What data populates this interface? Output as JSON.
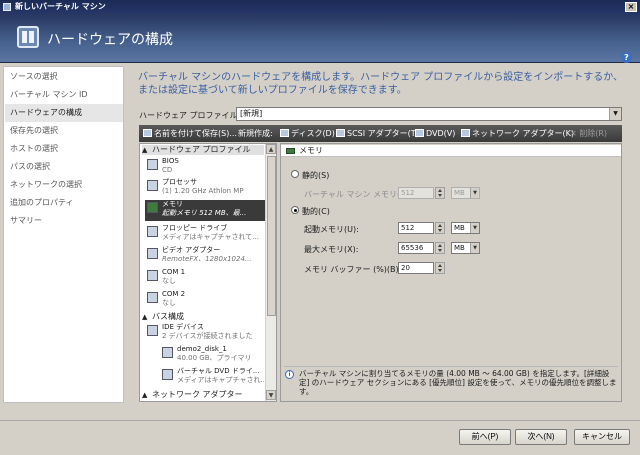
{
  "window": {
    "title": "新しいバーチャル マシン",
    "close_glyph": "×"
  },
  "header": {
    "title": "ハードウェアの構成",
    "help_glyph": "?"
  },
  "sidebar": {
    "items": [
      {
        "label": "ソースの選択",
        "active": false
      },
      {
        "label": "バーチャル マシン ID",
        "active": false
      },
      {
        "label": "ハードウェアの構成",
        "active": true
      },
      {
        "label": "保存先の選択",
        "active": false
      },
      {
        "label": "ホストの選択",
        "active": false
      },
      {
        "label": "パスの選択",
        "active": false
      },
      {
        "label": "ネットワークの選択",
        "active": false
      },
      {
        "label": "追加のプロパティ",
        "active": false
      },
      {
        "label": "サマリー",
        "active": false
      }
    ]
  },
  "intro": {
    "text": "バーチャル マシンのハードウェアを構成します。ハードウェア プロファイルから設定をインポートするか、または設定に基づいて新しいプロファイルを保存できます。"
  },
  "profile": {
    "label": "ハードウェア プロファイル(A):",
    "value": "[新規]"
  },
  "toolbar": {
    "save_as": "名前を付けて保存(S)...",
    "new": "新規作成:",
    "disk": "ディスク(D)",
    "scsi": "SCSI アダプター(T)",
    "dvd": "DVD(V)",
    "network": "ネットワーク アダプター(K)",
    "delete": "削除(R)"
  },
  "tree": {
    "cat_hw": "ハードウェア プロファイル",
    "cat_bus": "バス構成",
    "cat_net": "ネットワーク アダプター",
    "items": {
      "bios": {
        "name": "BIOS",
        "sub": "CD"
      },
      "cpu": {
        "name": "プロセッサ",
        "sub": "(1) 1.20 GHz Athlon MP"
      },
      "memory": {
        "name": "メモリ",
        "sub": "起動メモリ 512 MB、最..."
      },
      "floppy": {
        "name": "フロッピー ドライブ",
        "sub": "メディアはキャプチャされて..."
      },
      "video": {
        "name": "ビデオ アダプター",
        "sub": "RemoteFX、1280x1024..."
      },
      "com1": {
        "name": "COM 1",
        "sub": "なし"
      },
      "com2": {
        "name": "COM 2",
        "sub": "なし"
      },
      "ide": {
        "name": "IDE デバイス",
        "sub": "2 デバイスが接続されました"
      },
      "disk": {
        "name": "demo2_disk_1",
        "sub": "40.00 GB、プライマリ"
      },
      "dvd": {
        "name": "バーチャル DVD ドライ...",
        "sub": "メディアはキャプチャされ..."
      }
    }
  },
  "memory_pane": {
    "header": "メモリ",
    "static_label": "静的(S)",
    "static_mem_label": "バーチャル マシン メモリ(M):",
    "static_mem_value": "512",
    "static_mem_unit": "MB",
    "dynamic_label": "動的(C)",
    "startup_label": "起動メモリ(U):",
    "startup_value": "512",
    "startup_unit": "MB",
    "max_label": "最大メモリ(X):",
    "max_value": "65536",
    "max_unit": "MB",
    "buffer_label": "メモリ バッファー (%)(B):",
    "buffer_value": "20",
    "selected": "dynamic",
    "info_glyph": "i",
    "info_text": "バーチャル マシンに割り当てるメモリの量 (4.00 MB ～ 64.00 GB) を指定します。[詳細設定] のハードウェア セクションにある [優先順位] 設定を使って、メモリの優先順位を調整します。"
  },
  "buttons": {
    "prev": "前へ(P)",
    "next": "次へ(N)",
    "cancel": "キャンセル"
  }
}
